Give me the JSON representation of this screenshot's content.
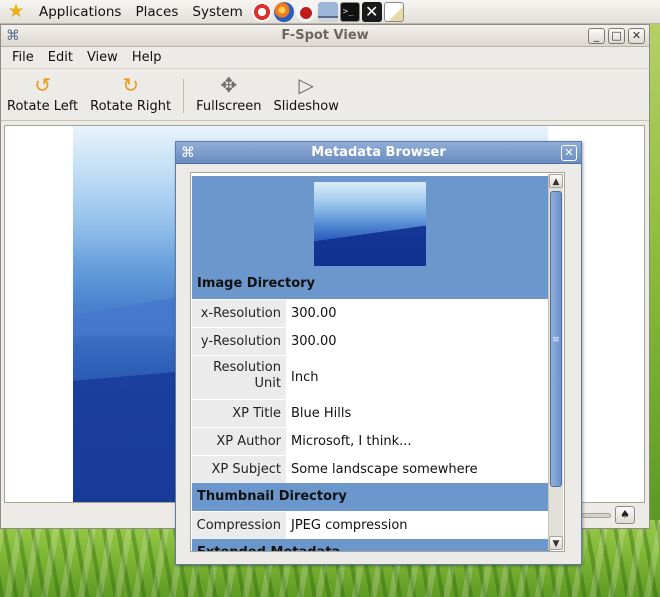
{
  "top_panel": {
    "menus": [
      "Applications",
      "Places",
      "System"
    ],
    "launchers": [
      "help-icon",
      "firefox-icon",
      "mail-icon",
      "monitor-icon",
      "terminal-icon",
      "x-icon",
      "text-editor-icon"
    ]
  },
  "fspot": {
    "title": "F-Spot View",
    "menu": {
      "file": "File",
      "edit": "Edit",
      "view": "View",
      "help": "Help"
    },
    "toolbar": {
      "rotate_left": "Rotate Left",
      "rotate_right": "Rotate Right",
      "fullscreen": "Fullscreen",
      "slideshow": "Slideshow"
    }
  },
  "metadata_browser": {
    "title": "Metadata Browser",
    "image_directory": {
      "header": "Image Directory",
      "rows": [
        {
          "key": "x-Resolution",
          "value": "300.00"
        },
        {
          "key": "y-Resolution",
          "value": "300.00"
        },
        {
          "key": "Resolution Unit",
          "value": "Inch"
        },
        {
          "key": "XP Title",
          "value": "Blue Hills"
        },
        {
          "key": "XP Author",
          "value": "Microsoft, I think..."
        },
        {
          "key": "XP Subject",
          "value": "Some landscape somewhere"
        }
      ]
    },
    "thumbnail_directory": {
      "header": "Thumbnail Directory",
      "rows": [
        {
          "key": "Compression",
          "value": "JPEG compression"
        }
      ]
    },
    "extended_metadata": {
      "header": "Extended Metadata"
    }
  },
  "colors": {
    "section_bg": "#6c97cc",
    "dialog_titlebar": "#7a99c9",
    "window_bg": "#edebe7"
  }
}
